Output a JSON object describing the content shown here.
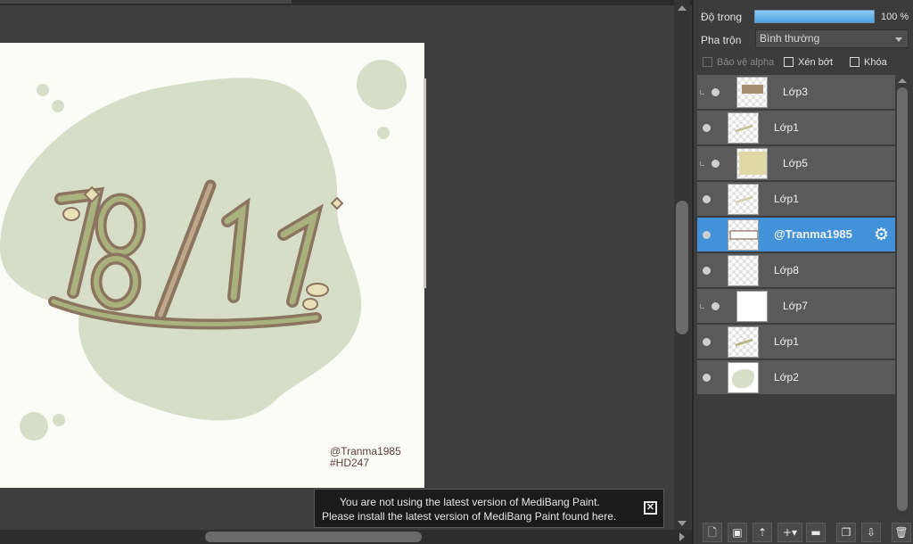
{
  "canvas": {
    "signature_line1": "@Tranma1985",
    "signature_line2": "#HD247",
    "artwork_text": "18/11"
  },
  "notification": {
    "line1": "You are not using the latest version of MediBang Paint.",
    "line2": "Please install the latest version of MediBang Paint found here.",
    "close_glyph": "✕"
  },
  "panel": {
    "opacity_label": "Độ trong",
    "opacity_value": "100 %",
    "opacity_level": 1.0,
    "blend_label": "Pha trộn",
    "blend_value": "Bình thường",
    "protect_alpha": "Bảo vệ alpha",
    "clipping": "Xén bớt",
    "lock": "Khóa",
    "layers": [
      {
        "name": "Lớp3",
        "clipped": true,
        "selected": false
      },
      {
        "name": "Lớp1",
        "clipped": false,
        "selected": false
      },
      {
        "name": "Lớp5",
        "clipped": true,
        "selected": false
      },
      {
        "name": "Lớp1",
        "clipped": false,
        "selected": false
      },
      {
        "name": "@Tranma1985",
        "clipped": false,
        "selected": true
      },
      {
        "name": "Lớp8",
        "clipped": false,
        "selected": false
      },
      {
        "name": "Lớp7",
        "clipped": true,
        "selected": false
      },
      {
        "name": "Lớp1",
        "clipped": false,
        "selected": false
      },
      {
        "name": "Lớp2",
        "clipped": false,
        "selected": false
      }
    ]
  },
  "toolbar_icons": [
    "new-layer-icon",
    "new-halftone-layer-icon",
    "import-layer-icon",
    "add-layer-menu-icon",
    "folder-icon",
    "duplicate-layer-icon",
    "merge-down-icon",
    "trash-icon"
  ],
  "colors": {
    "selection": "#4192d9",
    "artwork_blob": "#d6dec8",
    "artwork_brown": "#8c7560",
    "artwork_green": "#a9b17d"
  }
}
